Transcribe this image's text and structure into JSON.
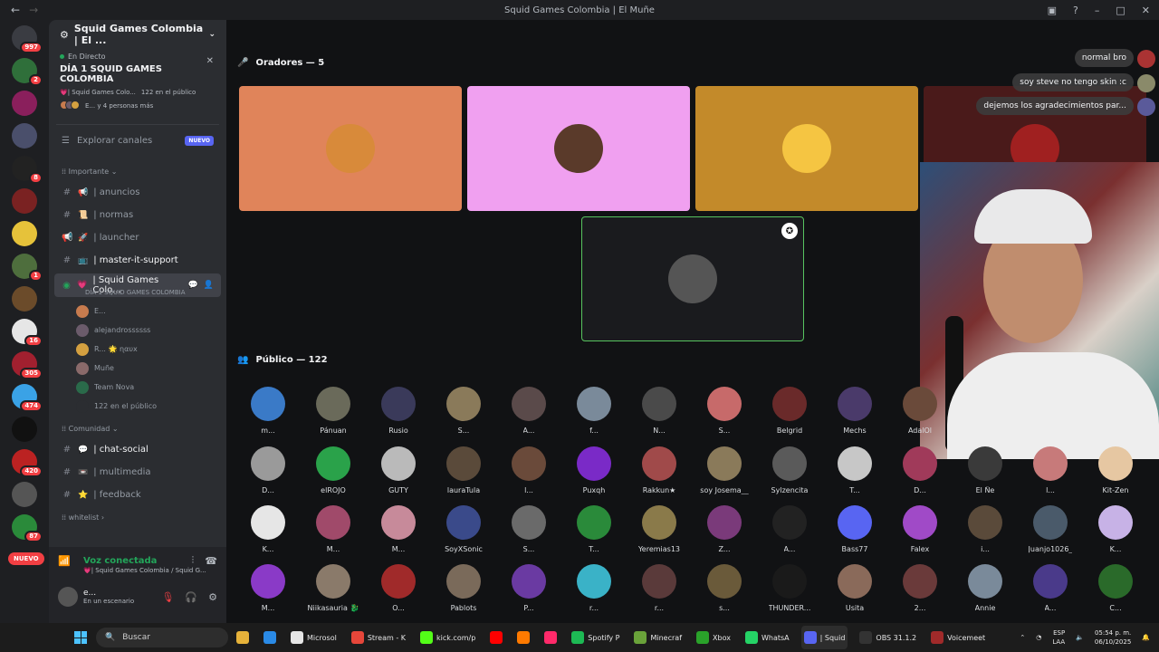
{
  "window": {
    "title": "Squid Games Colombia | El Muñe"
  },
  "rail": {
    "servers": [
      {
        "name": "server-1",
        "color": "#3a3c42",
        "badge": "997"
      },
      {
        "name": "server-2",
        "color": "#2f6f3a",
        "badge": "2"
      },
      {
        "name": "server-3",
        "color": "#8a1f5c",
        "badge": ""
      },
      {
        "name": "server-4",
        "color": "#4a4f6b",
        "badge": ""
      },
      {
        "name": "server-5",
        "color": "#222",
        "badge": "8"
      },
      {
        "name": "server-6",
        "color": "#7a2222",
        "badge": ""
      },
      {
        "name": "server-7",
        "color": "#e6c23a",
        "badge": ""
      },
      {
        "name": "server-8",
        "color": "#4e6e3d",
        "badge": "1"
      },
      {
        "name": "server-9",
        "color": "#6b4b2a",
        "badge": ""
      },
      {
        "name": "server-10",
        "color": "#e6e6e6",
        "badge": "16"
      },
      {
        "name": "server-11",
        "color": "#a1202f",
        "badge": "305"
      },
      {
        "name": "server-12",
        "color": "#3aa2e6",
        "badge": "474"
      },
      {
        "name": "server-13",
        "color": "#111",
        "badge": ""
      },
      {
        "name": "server-14",
        "color": "#b22",
        "badge": "420"
      },
      {
        "name": "server-15",
        "color": "#555",
        "badge": ""
      },
      {
        "name": "server-16",
        "color": "#2a8a3a",
        "badge": "87"
      }
    ],
    "new_label": "NUEVO"
  },
  "sidebar": {
    "server_name": "Squid Games Colombia | El ...",
    "live": {
      "tag": "En Directo",
      "title": "DÍA 1 SQUID GAMES COLOMBIA",
      "channel": "💗| Squid Games Colo...",
      "listeners": "122 en el público",
      "people": "E... y 4 personas más"
    },
    "explore_label": "Explorar canales",
    "explore_badge": "NUEVO",
    "cat_importante": "Importante",
    "channels_a": [
      {
        "name": "| anuncios",
        "emoji": "📢",
        "icon": "#"
      },
      {
        "name": "| normas",
        "emoji": "📜",
        "icon": "#"
      },
      {
        "name": "| launcher",
        "emoji": "🚀",
        "icon": "📢"
      },
      {
        "name": "| master-it-support",
        "emoji": "📺",
        "icon": "#",
        "unread": true
      }
    ],
    "active_channel": {
      "name": "| Squid Games Colo...",
      "sub": "DÍA 1 SQUID GAMES COLOMBIA"
    },
    "members": [
      {
        "name": "E...",
        "color": "#c77b4e"
      },
      {
        "name": "alejandrossssss",
        "color": "#6b5b6b"
      },
      {
        "name": "R... 🌟 ɳαυx",
        "color": "#d4a040"
      },
      {
        "name": "Muñe",
        "color": "#8a6a6a"
      },
      {
        "name": "Team Nova",
        "color": "#2a6a4a"
      },
      {
        "name": "122 en el público",
        "color": "#2b2d31"
      }
    ],
    "cat_comunidad": "Comunidad",
    "channels_b": [
      {
        "name": "| chat-social",
        "emoji": "💬",
        "icon": "#",
        "unread": true
      },
      {
        "name": "| multimedia",
        "emoji": "📼",
        "icon": "#"
      },
      {
        "name": "| feedback",
        "emoji": "⭐",
        "icon": "#"
      }
    ],
    "cat_whitelist": "whitelist"
  },
  "voice": {
    "title": "Voz conectada",
    "sub": "💗| Squid Games Colombia / Squid G...",
    "user": "e...",
    "status": "En un escenario"
  },
  "stage": {
    "speakers_header": "Oradores — 5",
    "audience_header": "Público — 122",
    "speakers": [
      {
        "bg": "#e0845a",
        "av": "#d88a3a"
      },
      {
        "bg": "#f0a0f0",
        "av": "#5a3a2a"
      },
      {
        "bg": "#c38a2a",
        "av": "#f5c542"
      },
      {
        "bg": "#4a1a1a",
        "av": "#a02020"
      }
    ],
    "selected_speaker": {
      "av": "#555"
    },
    "chat": [
      {
        "text": "normal bro",
        "av": "#a33"
      },
      {
        "text": "soy steve no tengo skin :c",
        "av": "#8a8a6a"
      },
      {
        "text": "dejemos los agradecimientos par...",
        "av": "#5a5a9a"
      }
    ],
    "audience": [
      {
        "name": "m...",
        "color": "#3a7ac7"
      },
      {
        "name": "Pánuan",
        "color": "#6a6a5a"
      },
      {
        "name": "Rusio",
        "color": "#3a3a5a"
      },
      {
        "name": "S...",
        "color": "#8a7a5a"
      },
      {
        "name": "A...",
        "color": "#5a4a4a"
      },
      {
        "name": "f...",
        "color": "#7a8a9a"
      },
      {
        "name": "N...",
        "color": "#4a4a4a"
      },
      {
        "name": "S...",
        "color": "#c76a6a"
      },
      {
        "name": "Belgrid",
        "color": "#6a2a2a"
      },
      {
        "name": "Mechs",
        "color": "#4a3a6a"
      },
      {
        "name": "D...",
        "color": "#9a9a9a"
      },
      {
        "name": "elROJO",
        "color": "#2aa24a"
      },
      {
        "name": "GUTY",
        "color": "#bababa"
      },
      {
        "name": "lauraTula",
        "color": "#5a4a3a"
      },
      {
        "name": "l...",
        "color": "#6a4a3a"
      },
      {
        "name": "Puxqh",
        "color": "#7a2ac7"
      },
      {
        "name": "Rakkun★",
        "color": "#a04a4a"
      },
      {
        "name": "soy Josema__",
        "color": "#8a7a5a"
      },
      {
        "name": "Sylzencita",
        "color": "#5a5a5a"
      },
      {
        "name": "T...",
        "color": "#c7c7c7"
      },
      {
        "name": "K...",
        "color": "#e6e6e6"
      },
      {
        "name": "M...",
        "color": "#a04a6a"
      },
      {
        "name": "M...",
        "color": "#c78a9a"
      },
      {
        "name": "SoyXSonic",
        "color": "#3a4a8a"
      },
      {
        "name": "S...",
        "color": "#6a6a6a"
      },
      {
        "name": "T...",
        "color": "#2a8a3a"
      },
      {
        "name": "Yeremias13",
        "color": "#8a7a4a"
      },
      {
        "name": "Z...",
        "color": "#7a3a7a"
      },
      {
        "name": "A...",
        "color": "#222"
      },
      {
        "name": "Bass77",
        "color": "#5865f2"
      },
      {
        "name": "M...",
        "color": "#8a3ac7"
      },
      {
        "name": "Niikasauria 🐉",
        "color": "#8a7a6a"
      },
      {
        "name": "O...",
        "color": "#a02a2a"
      },
      {
        "name": "Pablots",
        "color": "#7a6a5a"
      },
      {
        "name": "P...",
        "color": "#6a3aa2"
      },
      {
        "name": "r...",
        "color": "#3ab2c7"
      },
      {
        "name": "r...",
        "color": "#5a3a3a"
      },
      {
        "name": "s...",
        "color": "#6a5a3a"
      },
      {
        "name": "THUNDER...",
        "color": "#1a1a1a"
      },
      {
        "name": "Usita",
        "color": "#8a6a5a"
      }
    ],
    "audience_right": [
      {
        "name": "AdalOl",
        "color": "#6a4a3a"
      },
      {
        "name": "D...",
        "color": "#a03a5a"
      },
      {
        "name": "El Ñe",
        "color": "#3a3a3a"
      },
      {
        "name": "l...",
        "color": "#c77a7a"
      },
      {
        "name": "Kit-Zen",
        "color": "#e6c7a2"
      },
      {
        "name": "Falex",
        "color": "#a04ac7"
      },
      {
        "name": "i...",
        "color": "#5a4a3a"
      },
      {
        "name": "Juanjo1026_",
        "color": "#4a5a6a"
      },
      {
        "name": "K...",
        "color": "#c7b2e6"
      },
      {
        "name": "2...",
        "color": "#6a3a3a"
      },
      {
        "name": "Annie",
        "color": "#7a8a9a"
      },
      {
        "name": "A...",
        "color": "#4a3a8a"
      },
      {
        "name": "C...",
        "color": "#2a6a2a"
      }
    ]
  },
  "taskbar": {
    "search": "Buscar",
    "apps": [
      {
        "label": "",
        "color": "#e6b23a"
      },
      {
        "label": "",
        "color": "#2a8ae6"
      },
      {
        "label": "Microsol",
        "color": "#e6e6e6"
      },
      {
        "label": "Stream - K",
        "color": "#e6463a"
      },
      {
        "label": "kick.com/p",
        "color": "#53fc18"
      },
      {
        "label": "",
        "color": "#ff0000"
      },
      {
        "label": "",
        "color": "#ff7a00"
      },
      {
        "label": "",
        "color": "#ff2a6a"
      },
      {
        "label": "Spotify P",
        "color": "#1db954"
      },
      {
        "label": "Minecraf",
        "color": "#6aa23a"
      },
      {
        "label": "Xbox",
        "color": "#2aa22a"
      },
      {
        "label": "WhatsA",
        "color": "#25d366"
      },
      {
        "label": "| Squid",
        "color": "#5865f2"
      },
      {
        "label": "OBS 31.1.2",
        "color": "#333"
      },
      {
        "label": "Voicemeet",
        "color": "#a02a2a"
      }
    ],
    "lang": "ESP",
    "lang2": "LAA",
    "time": "05:54 p. m.",
    "date": "06/10/2025"
  }
}
